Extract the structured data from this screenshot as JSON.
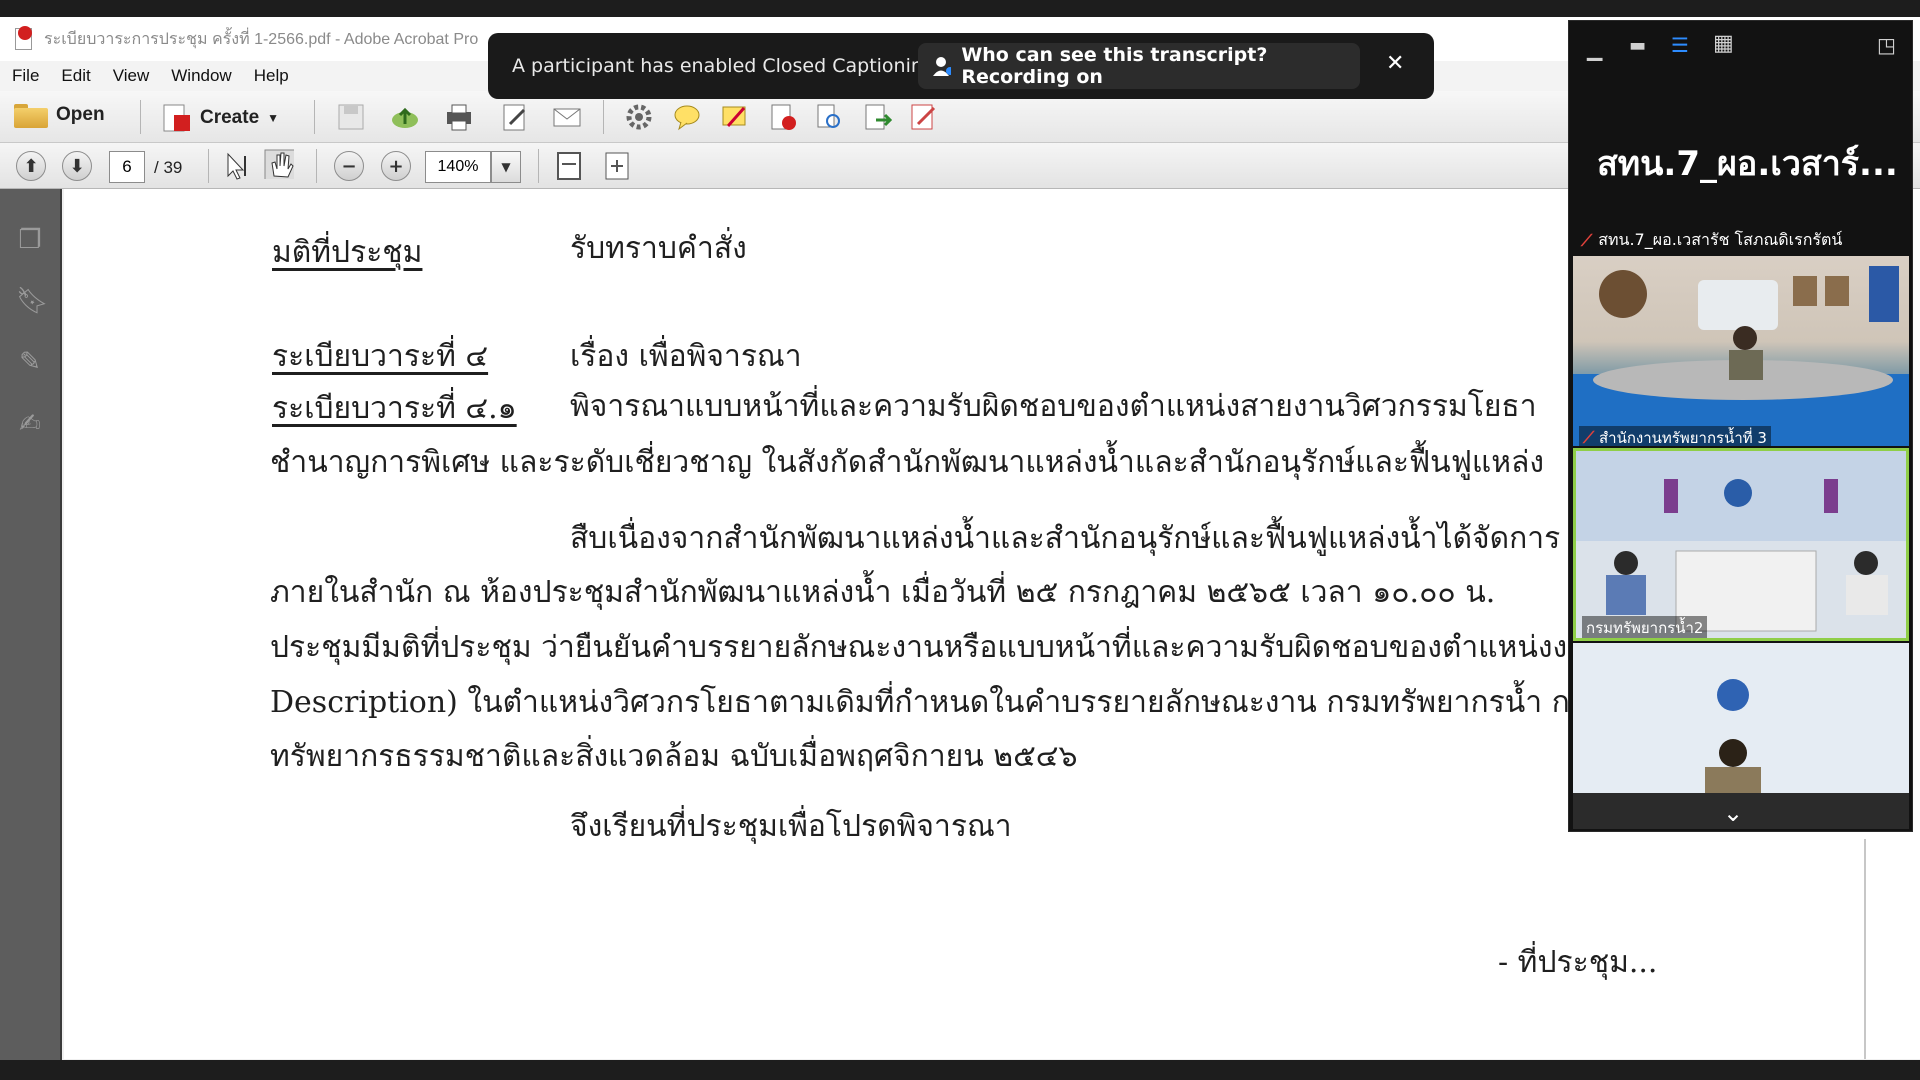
{
  "window": {
    "title": "ระเบียบวาระการประชุม ครั้งที่ 1-2566.pdf - Adobe Acrobat Pro"
  },
  "menu": [
    "File",
    "Edit",
    "View",
    "Window",
    "Help"
  ],
  "toolbar": {
    "open_label": "Open",
    "create_label": "Create"
  },
  "navigation": {
    "current_page": "6",
    "total_pages": "/ 39",
    "zoom": "140%"
  },
  "caption_banner": {
    "message": "A participant has enabled Closed Captioning",
    "transcript_prompt": "Who can see this transcript? Recording on"
  },
  "document": {
    "resolution_heading": "มติที่ประชุม",
    "resolution_text": "รับทราบคำสั่ง",
    "agenda4_label": "ระเบียบวาระที่ ๔",
    "agenda4_text": "เรื่อง เพื่อพิจารณา",
    "agenda41_label": "ระเบียบวาระที่ ๔.๑",
    "agenda41_text": "พิจารณาแบบหน้าที่และความรับผิดชอบของตำแหน่งสายงานวิศวกรรมโยธา",
    "line3": "ชำนาญการพิเศษ และระดับเชี่ยวชาญ ในสังกัดสำนักพัฒนาแหล่งน้ำและสำนักอนุรักษ์และฟื้นฟูแหล่ง",
    "line4": "สืบเนื่องจากสำนักพัฒนาแหล่งน้ำและสำนักอนุรักษ์และฟื้นฟูแหล่งน้ำได้จัดการ",
    "line5": "ภายในสำนัก ณ ห้องประชุมสำนักพัฒนาแหล่งน้ำ เมื่อวันที่ ๒๕ กรกฎาคม ๒๕๖๕ เวลา ๑๐.๐๐ น.",
    "line6": "ประชุมมีมติที่ประชุม ว่ายืนยันคำบรรยายลักษณะงานหรือแบบหน้าที่และความรับผิดชอบของตำแหน่งงา",
    "line7": "Description) ในตำแหน่งวิศวกรโยธาตามเดิมที่กำหนดในคำบรรยายลักษณะงาน กรมทรัพยากรน้ำ กร",
    "line8": "ทรัพยากรธรรมชาติและสิ่งแวดล้อม ฉบับเมื่อพฤศจิกายน ๒๕๔๖",
    "line9": "จึงเรียนที่ประชุมเพื่อโปรดพิจารณา",
    "footer_next": "- ที่ประชุม..."
  },
  "zoom_panel": {
    "active_speaker": "สทน.7_ผอ.เวสาร์...",
    "participants": [
      {
        "name": "สทน.7_ผอ.เวสารัช โสภณดิเรกรัตน์",
        "muted": true
      },
      {
        "name": "สำนักงานทรัพยากรน้ำที่ 3",
        "muted": true
      },
      {
        "name": "กรมทรัพยากรน้ำ2",
        "muted": false
      }
    ]
  },
  "colors": {
    "accent_blue": "#2d8cff",
    "mute_red": "#e0413b",
    "speaker_border": "#8fce48"
  }
}
